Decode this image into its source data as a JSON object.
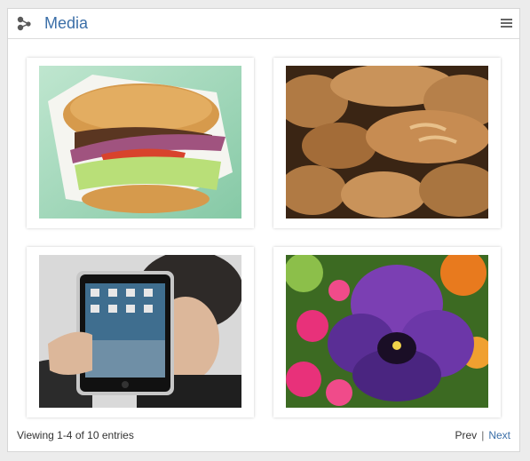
{
  "widget": {
    "title": "Media",
    "accent_color": "#3b6fa8"
  },
  "media": {
    "items": [
      {
        "subject": "burger",
        "icon": "photo"
      },
      {
        "subject": "bread-loaves",
        "icon": "photo"
      },
      {
        "subject": "tablet-person",
        "icon": "photo"
      },
      {
        "subject": "pansy-flower",
        "icon": "photo"
      }
    ]
  },
  "footer": {
    "entries_info": "Viewing 1-4 of 10 entries",
    "prev_label": "Prev",
    "separator": "|",
    "next_label": "Next"
  }
}
